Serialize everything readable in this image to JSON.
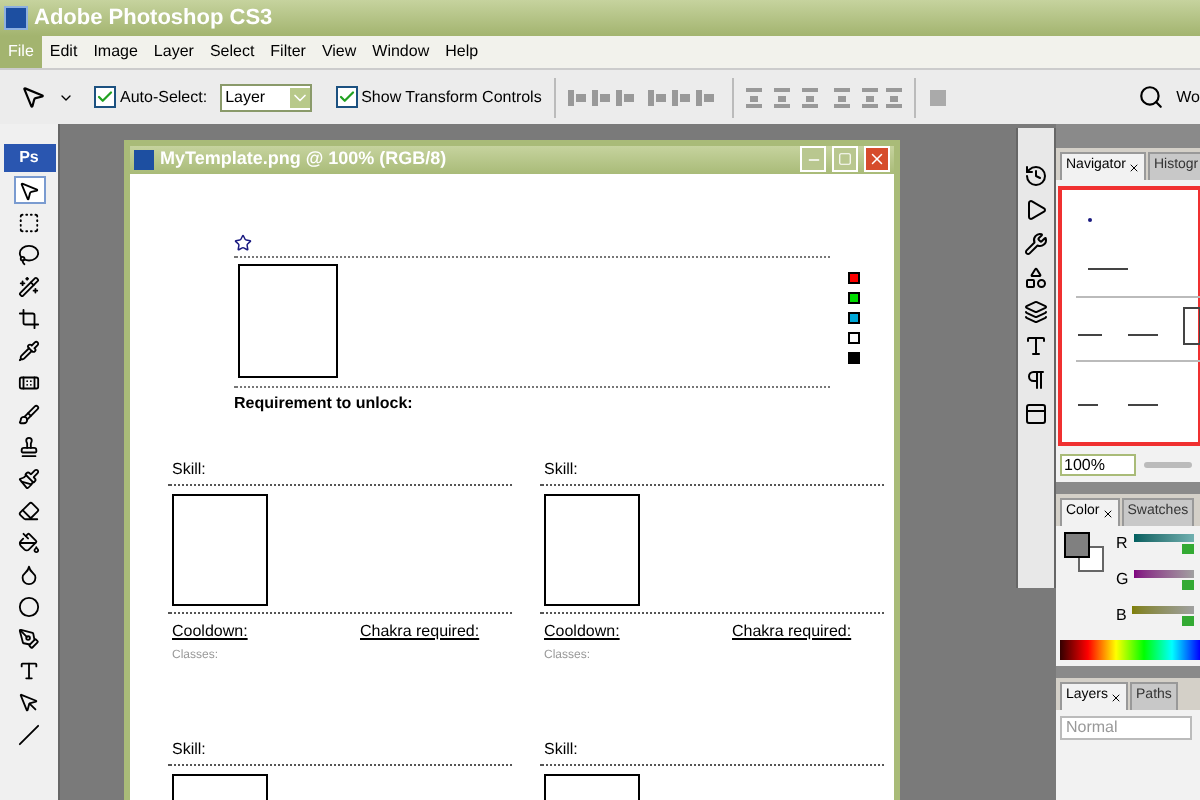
{
  "app_title": "Adobe Photoshop CS3",
  "menu": [
    {
      "label": "File",
      "selected": true
    },
    {
      "label": "Edit",
      "selected": false
    },
    {
      "label": "Image",
      "selected": false
    },
    {
      "label": "Layer",
      "selected": false
    },
    {
      "label": "Select",
      "selected": false
    },
    {
      "label": "Filter",
      "selected": false
    },
    {
      "label": "View",
      "selected": false
    },
    {
      "label": "Window",
      "selected": false
    },
    {
      "label": "Help",
      "selected": false
    }
  ],
  "options_bar": {
    "auto_select": {
      "label": "Auto-Select:",
      "checked": true
    },
    "auto_select_target": "Layer",
    "transform_controls": {
      "label": "Show Transform Controls",
      "checked": true
    },
    "workspace_label": "Wo"
  },
  "tools_logo": "Ps",
  "tools": [
    {
      "kind": "move",
      "selected": true
    },
    {
      "kind": "marquee",
      "selected": false
    },
    {
      "kind": "lasso",
      "selected": false
    },
    {
      "kind": "wand",
      "selected": false
    },
    {
      "kind": "crop",
      "selected": false
    },
    {
      "kind": "eyedropper",
      "selected": false
    },
    {
      "kind": "heal",
      "selected": false
    },
    {
      "kind": "brush",
      "selected": false
    },
    {
      "kind": "stamp",
      "selected": false
    },
    {
      "kind": "history",
      "selected": false
    },
    {
      "kind": "eraser",
      "selected": false
    },
    {
      "kind": "bucket",
      "selected": false
    },
    {
      "kind": "smudge",
      "selected": false
    },
    {
      "kind": "dodge",
      "selected": false
    },
    {
      "kind": "pen",
      "selected": false
    },
    {
      "kind": "type",
      "selected": false
    },
    {
      "kind": "path",
      "selected": false
    },
    {
      "kind": "line",
      "selected": false
    }
  ],
  "document": {
    "title": "MyTemplate.png @ 100% (RGB/8)",
    "requirement_label": "Requirement to unlock:",
    "swatches": [
      {
        "color": "#ff0000"
      },
      {
        "color": "#00dd00"
      },
      {
        "color": "#00a8d8"
      },
      {
        "color": "#ffffff"
      },
      {
        "color": "#000000"
      }
    ],
    "skill_rows": [
      [
        {
          "skill_label": "Skill:",
          "cooldown_label": "Cooldown:",
          "chakra_label": "Chakra required:",
          "classes_label": "Classes:"
        },
        {
          "skill_label": "Skill:",
          "cooldown_label": "Cooldown:",
          "chakra_label": "Chakra required:",
          "classes_label": "Classes:"
        }
      ],
      [
        {
          "skill_label": "Skill:"
        },
        {
          "skill_label": "Skill:"
        }
      ]
    ]
  },
  "navigator": {
    "tabs": [
      {
        "label": "Navigator",
        "selected": true
      },
      {
        "label": "Histogr",
        "selected": false
      }
    ],
    "zoom": "100%"
  },
  "color_panel": {
    "tabs": [
      {
        "label": "Color",
        "selected": true
      },
      {
        "label": "Swatches",
        "selected": false
      }
    ],
    "channels": [
      {
        "name": "R",
        "level": 0.9
      },
      {
        "name": "G",
        "level": 0.9
      },
      {
        "name": "B",
        "level": 0.9
      }
    ]
  },
  "layers_panel": {
    "tabs": [
      {
        "label": "Layers",
        "selected": true
      },
      {
        "label": "Paths",
        "selected": false
      }
    ],
    "blend_mode": "Normal"
  }
}
